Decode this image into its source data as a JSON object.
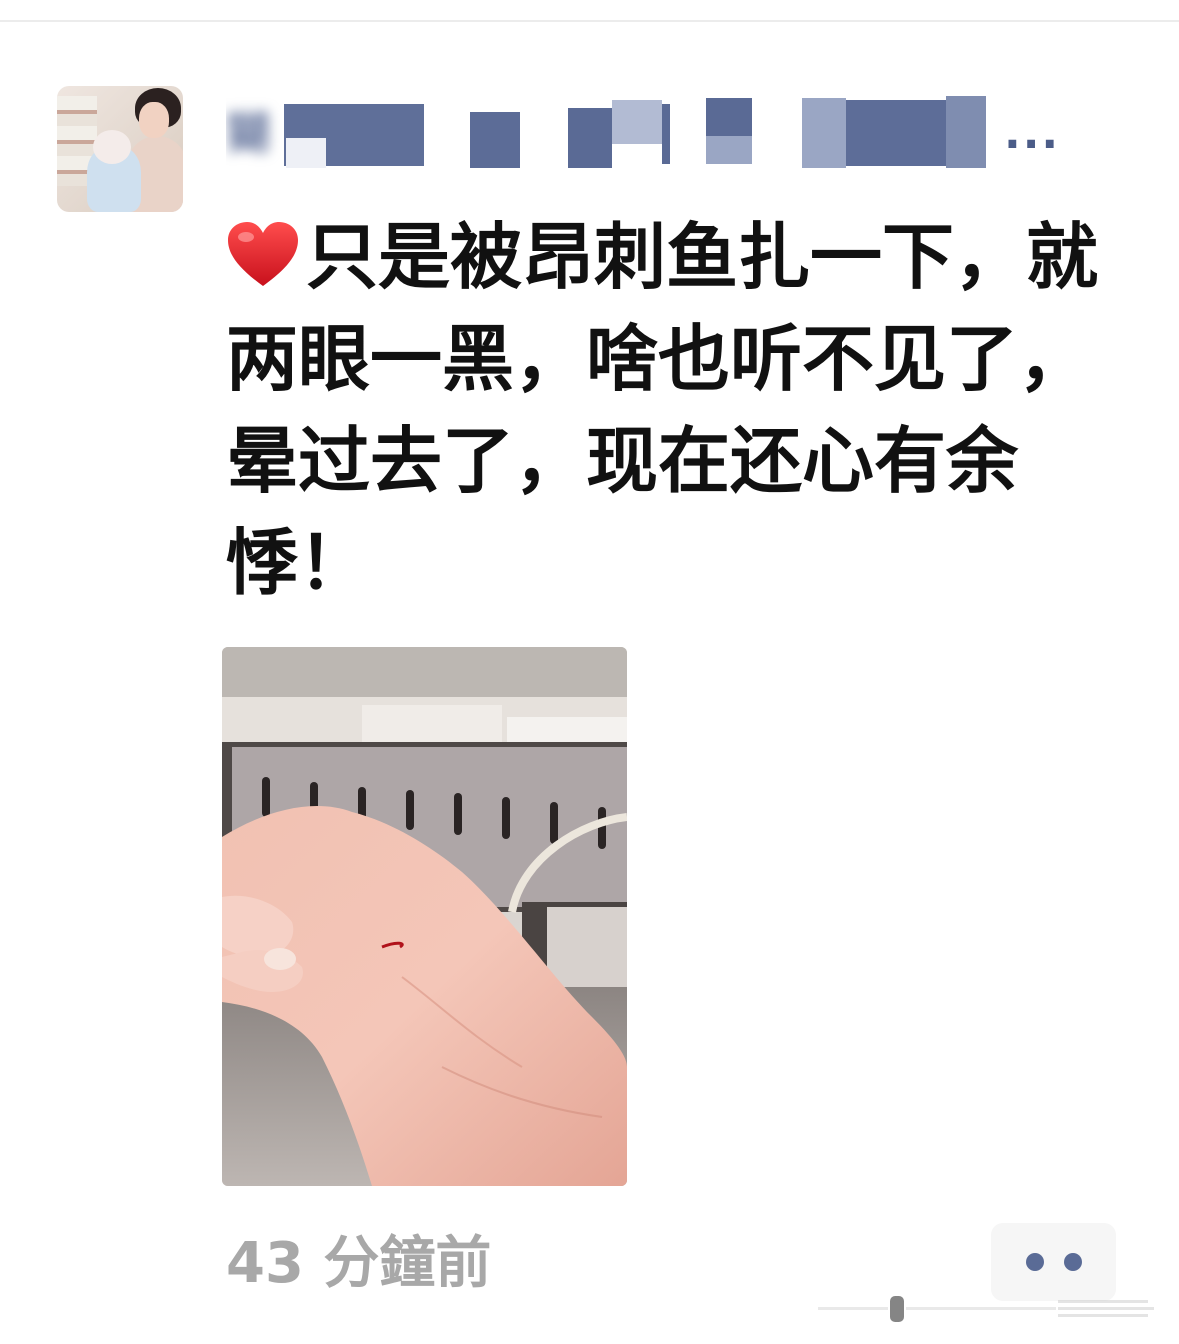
{
  "post": {
    "username": "猢",
    "username_truncation": "...",
    "text": "只是被昂刺鱼扎一下，就\n两眼一黑，啥也听不见了，\n晕过去了，现在还心有余\n悸！",
    "emoji_icon": "red-heart-icon",
    "timestamp": "43 分鐘前"
  },
  "more_button": {
    "icon": "more-dots-icon"
  },
  "colors": {
    "username": "#5a6b96",
    "text": "#111111",
    "timestamp": "#a8a8a8",
    "more_dots": "#5a6b96",
    "heart": "#e0202a"
  }
}
